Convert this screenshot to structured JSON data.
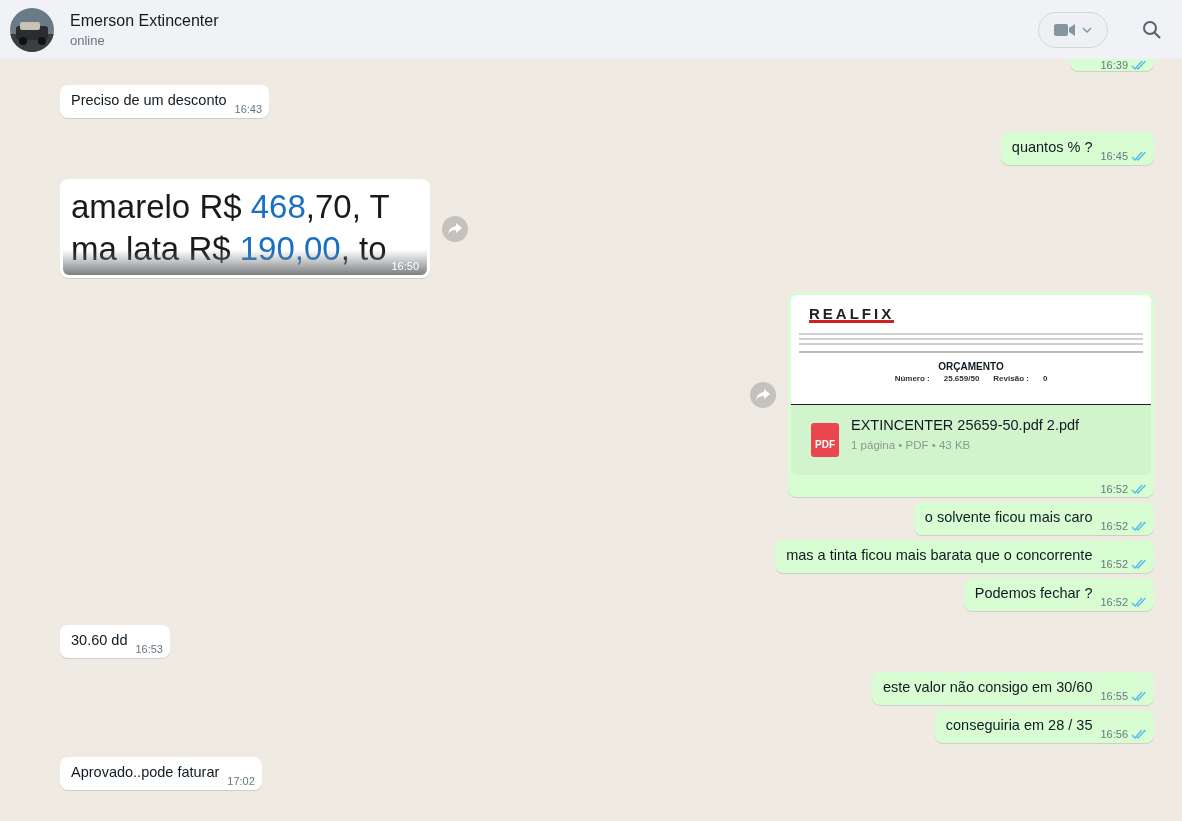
{
  "header": {
    "name": "Emerson Extincenter",
    "status": "online"
  },
  "messages": [
    {
      "kind": "text",
      "outgoing": true,
      "time": "16:39",
      "read": true
    },
    {
      "kind": "text",
      "outgoing": false,
      "text": "Preciso de um desconto",
      "time": "16:43"
    },
    {
      "kind": "text",
      "outgoing": true,
      "text": "quantos % ?",
      "time": "16:45",
      "read": true
    },
    {
      "outgoing": false,
      "time": "16:50",
      "lines": [
        [
          {
            "text": "amarelo R$ ",
            "highlighted": false
          },
          {
            "text": "468",
            "highlighted": true
          },
          {
            "text": ",70, T",
            "highlighted": false
          }
        ],
        [
          {
            "text": "ma lata R$ ",
            "highlighted": false
          },
          {
            "text": "190,00",
            "highlighted": true
          },
          {
            "text": ", to",
            "highlighted": false
          }
        ]
      ]
    },
    {
      "kind": "document",
      "outgoing": true,
      "time": "16:52",
      "read": true,
      "preview": {
        "logo": "REALFIX",
        "title": "ORÇAMENTO",
        "number_label": "Número :",
        "number": "25.659/50",
        "revision_label": "Revisão :",
        "revision": "0"
      },
      "file_name": "EXTINCENTER 25659-50.pdf 2.pdf",
      "file_type": "PDF",
      "file_info": "1 página • PDF • 43 KB"
    },
    {
      "kind": "text",
      "outgoing": true,
      "text": "o solvente ficou mais caro",
      "time": "16:52",
      "read": true
    },
    {
      "kind": "text",
      "outgoing": true,
      "text": "mas a tinta ficou mais barata que o concorrente",
      "time": "16:52",
      "read": true
    },
    {
      "kind": "text",
      "outgoing": true,
      "text": "Podemos fechar ?",
      "time": "16:52",
      "read": true
    },
    {
      "kind": "text",
      "outgoing": false,
      "text": "30.60 dd",
      "time": "16:53"
    },
    {
      "kind": "text",
      "outgoing": true,
      "text": "este valor não consigo em 30/60",
      "time": "16:55",
      "read": true
    },
    {
      "kind": "text",
      "outgoing": true,
      "text": "conseguiria em 28 / 35",
      "time": "16:56",
      "read": true
    },
    {
      "kind": "text",
      "outgoing": false,
      "text": "Aprovado..pode faturar",
      "time": "17:02"
    }
  ]
}
